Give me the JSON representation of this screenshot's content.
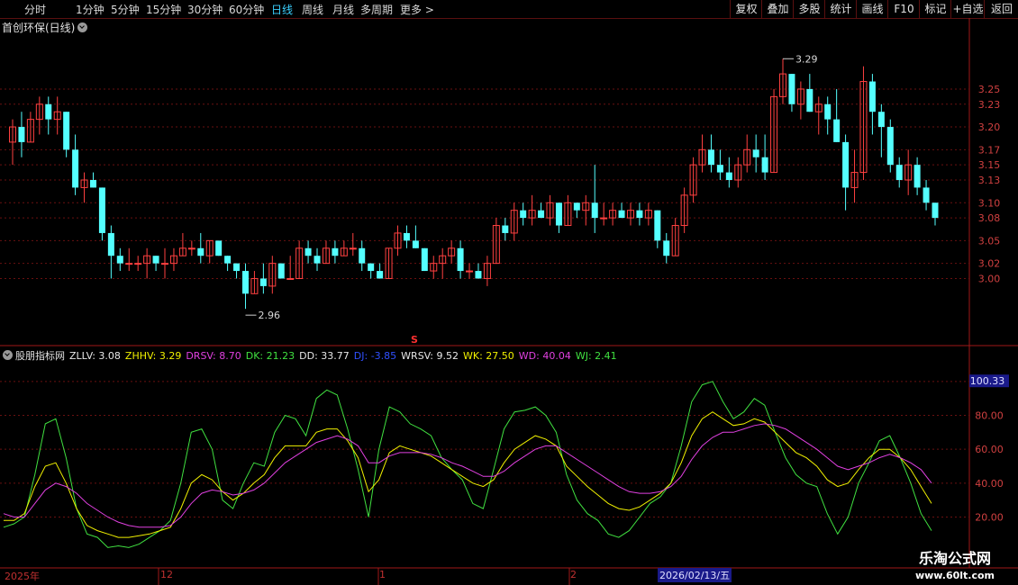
{
  "toolbar": {
    "periods": [
      "分时",
      "1分钟",
      "5分钟",
      "15分钟",
      "30分钟",
      "60分钟",
      "日线",
      "周线",
      "月线",
      "多周期",
      "更多 >"
    ],
    "active_period": "日线",
    "tools": [
      "复权",
      "叠加",
      "多股",
      "统计",
      "画线",
      "F10",
      "标记",
      "+自选",
      "返回"
    ]
  },
  "main_title": "首创环保(日线)",
  "price_axis": [
    "3.25",
    "3.23",
    "3.20",
    "3.17",
    "3.15",
    "3.13",
    "3.10",
    "3.08",
    "3.05",
    "3.02",
    "3.00"
  ],
  "high_label": "3.29",
  "low_label": "2.96",
  "marker_s": "S",
  "indicator": {
    "name": "股朋指标网",
    "values": [
      {
        "label": "ZLLV:",
        "value": "3.08",
        "color": "#e8e8e8"
      },
      {
        "label": "ZHHV:",
        "value": "3.29",
        "color": "#f0f000"
      },
      {
        "label": "DRSV:",
        "value": "8.70",
        "color": "#e040e0"
      },
      {
        "label": "DK:",
        "value": "21.23",
        "color": "#40e040"
      },
      {
        "label": "DD:",
        "value": "33.77",
        "color": "#e8e8e8"
      },
      {
        "label": "DJ:",
        "value": "-3.85",
        "color": "#3050ff"
      },
      {
        "label": "WRSV:",
        "value": "9.52",
        "color": "#e8e8e8"
      },
      {
        "label": "WK:",
        "value": "27.50",
        "color": "#f0f000"
      },
      {
        "label": "WD:",
        "value": "40.04",
        "color": "#e040e0"
      },
      {
        "label": "WJ:",
        "value": "2.41",
        "color": "#40e040"
      }
    ],
    "axis": [
      "100.00",
      "80.00",
      "60.00",
      "40.00",
      "20.00"
    ],
    "current": "100.33"
  },
  "date_labels": [
    "2025年",
    "12",
    "1",
    "2"
  ],
  "cursor_date": "2026/02/13/五",
  "watermark": {
    "line1": "乐淘公式网",
    "line2": "www.60lt.com"
  },
  "chart_data": [
    {
      "type": "candlestick",
      "title": "首创环保(日线)",
      "y_range": [
        2.94,
        3.32
      ],
      "candles": [
        [
          3.18,
          3.21,
          3.15,
          3.2
        ],
        [
          3.2,
          3.22,
          3.16,
          3.18
        ],
        [
          3.18,
          3.22,
          3.18,
          3.21
        ],
        [
          3.21,
          3.24,
          3.19,
          3.23
        ],
        [
          3.23,
          3.24,
          3.19,
          3.21
        ],
        [
          3.21,
          3.24,
          3.19,
          3.22
        ],
        [
          3.22,
          3.22,
          3.16,
          3.17
        ],
        [
          3.17,
          3.19,
          3.11,
          3.12
        ],
        [
          3.12,
          3.14,
          3.1,
          3.13
        ],
        [
          3.13,
          3.14,
          3.12,
          3.12
        ],
        [
          3.12,
          3.12,
          3.05,
          3.06
        ],
        [
          3.06,
          3.07,
          3.0,
          3.03
        ],
        [
          3.03,
          3.04,
          3.01,
          3.02
        ],
        [
          3.02,
          3.04,
          3.01,
          3.02
        ],
        [
          3.02,
          3.03,
          3.01,
          3.02
        ],
        [
          3.02,
          3.04,
          3.0,
          3.03
        ],
        [
          3.03,
          3.03,
          3.01,
          3.02
        ],
        [
          3.02,
          3.04,
          3.0,
          3.02
        ],
        [
          3.02,
          3.04,
          3.01,
          3.03
        ],
        [
          3.03,
          3.06,
          3.03,
          3.04
        ],
        [
          3.04,
          3.05,
          3.03,
          3.04
        ],
        [
          3.04,
          3.06,
          3.02,
          3.03
        ],
        [
          3.03,
          3.05,
          3.02,
          3.05
        ],
        [
          3.05,
          3.05,
          3.03,
          3.03
        ],
        [
          3.03,
          3.03,
          3.01,
          3.02
        ],
        [
          3.02,
          3.02,
          3.0,
          3.01
        ],
        [
          3.01,
          3.02,
          2.96,
          2.98
        ],
        [
          2.98,
          3.01,
          2.98,
          3.0
        ],
        [
          3.0,
          3.02,
          2.98,
          2.99
        ],
        [
          2.99,
          3.03,
          2.98,
          3.02
        ],
        [
          3.02,
          3.02,
          3.0,
          3.0
        ],
        [
          3.0,
          3.03,
          3.0,
          3.0
        ],
        [
          3.0,
          3.05,
          3.0,
          3.04
        ],
        [
          3.04,
          3.05,
          3.02,
          3.03
        ],
        [
          3.03,
          3.04,
          3.01,
          3.02
        ],
        [
          3.02,
          3.05,
          3.02,
          3.04
        ],
        [
          3.04,
          3.05,
          3.02,
          3.03
        ],
        [
          3.03,
          3.05,
          3.03,
          3.04
        ],
        [
          3.04,
          3.06,
          3.03,
          3.04
        ],
        [
          3.04,
          3.05,
          3.01,
          3.02
        ],
        [
          3.02,
          3.02,
          3.0,
          3.01
        ],
        [
          3.01,
          3.02,
          3.0,
          3.0
        ],
        [
          3.0,
          3.04,
          3.0,
          3.04
        ],
        [
          3.04,
          3.07,
          3.03,
          3.06
        ],
        [
          3.06,
          3.07,
          3.04,
          3.05
        ],
        [
          3.05,
          3.07,
          3.04,
          3.04
        ],
        [
          3.04,
          3.04,
          3.01,
          3.01
        ],
        [
          3.01,
          3.03,
          3.0,
          3.02
        ],
        [
          3.02,
          3.04,
          3.0,
          3.03
        ],
        [
          3.03,
          3.05,
          3.02,
          3.04
        ],
        [
          3.04,
          3.05,
          3.0,
          3.01
        ],
        [
          3.01,
          3.02,
          3.0,
          3.01
        ],
        [
          3.01,
          3.02,
          3.0,
          3.0
        ],
        [
          3.0,
          3.03,
          2.99,
          3.02
        ],
        [
          3.02,
          3.08,
          3.02,
          3.07
        ],
        [
          3.07,
          3.08,
          3.05,
          3.06
        ],
        [
          3.06,
          3.1,
          3.05,
          3.09
        ],
        [
          3.09,
          3.1,
          3.07,
          3.08
        ],
        [
          3.08,
          3.11,
          3.07,
          3.09
        ],
        [
          3.09,
          3.1,
          3.08,
          3.08
        ],
        [
          3.08,
          3.11,
          3.07,
          3.1
        ],
        [
          3.1,
          3.1,
          3.06,
          3.07
        ],
        [
          3.07,
          3.11,
          3.07,
          3.1
        ],
        [
          3.1,
          3.1,
          3.08,
          3.09
        ],
        [
          3.09,
          3.11,
          3.07,
          3.1
        ],
        [
          3.1,
          3.15,
          3.06,
          3.08
        ],
        [
          3.08,
          3.1,
          3.07,
          3.08
        ],
        [
          3.08,
          3.1,
          3.07,
          3.09
        ],
        [
          3.09,
          3.1,
          3.08,
          3.08
        ],
        [
          3.08,
          3.1,
          3.07,
          3.09
        ],
        [
          3.09,
          3.1,
          3.07,
          3.08
        ],
        [
          3.08,
          3.1,
          3.07,
          3.09
        ],
        [
          3.09,
          3.09,
          3.04,
          3.05
        ],
        [
          3.05,
          3.06,
          3.02,
          3.03
        ],
        [
          3.03,
          3.08,
          3.03,
          3.07
        ],
        [
          3.07,
          3.12,
          3.06,
          3.11
        ],
        [
          3.11,
          3.16,
          3.1,
          3.15
        ],
        [
          3.15,
          3.19,
          3.14,
          3.17
        ],
        [
          3.17,
          3.19,
          3.14,
          3.15
        ],
        [
          3.15,
          3.17,
          3.13,
          3.14
        ],
        [
          3.14,
          3.16,
          3.12,
          3.13
        ],
        [
          3.13,
          3.16,
          3.12,
          3.15
        ],
        [
          3.15,
          3.19,
          3.14,
          3.17
        ],
        [
          3.17,
          3.19,
          3.14,
          3.16
        ],
        [
          3.16,
          3.19,
          3.13,
          3.14
        ],
        [
          3.14,
          3.25,
          3.14,
          3.24
        ],
        [
          3.24,
          3.29,
          3.23,
          3.27
        ],
        [
          3.27,
          3.27,
          3.22,
          3.23
        ],
        [
          3.23,
          3.26,
          3.21,
          3.25
        ],
        [
          3.25,
          3.27,
          3.22,
          3.22
        ],
        [
          3.22,
          3.24,
          3.19,
          3.23
        ],
        [
          3.23,
          3.24,
          3.19,
          3.21
        ],
        [
          3.21,
          3.25,
          3.18,
          3.18
        ],
        [
          3.18,
          3.19,
          3.09,
          3.12
        ],
        [
          3.12,
          3.17,
          3.1,
          3.14
        ],
        [
          3.14,
          3.28,
          3.13,
          3.26
        ],
        [
          3.26,
          3.27,
          3.19,
          3.22
        ],
        [
          3.22,
          3.23,
          3.16,
          3.2
        ],
        [
          3.2,
          3.21,
          3.14,
          3.15
        ],
        [
          3.15,
          3.16,
          3.12,
          3.13
        ],
        [
          3.13,
          3.17,
          3.11,
          3.15
        ],
        [
          3.15,
          3.16,
          3.11,
          3.12
        ],
        [
          3.12,
          3.13,
          3.09,
          3.1
        ],
        [
          3.1,
          3.1,
          3.07,
          3.08
        ]
      ]
    },
    {
      "type": "line",
      "title": "股朋指标网",
      "y_range": [
        -10,
        110
      ],
      "series": [
        {
          "name": "DK",
          "color": "#40e040",
          "values": [
            14,
            16,
            20,
            45,
            75,
            78,
            55,
            25,
            10,
            8,
            2,
            3,
            2,
            4,
            8,
            12,
            18,
            40,
            70,
            72,
            60,
            30,
            25,
            40,
            52,
            50,
            70,
            80,
            78,
            68,
            90,
            95,
            92,
            72,
            48,
            20,
            60,
            85,
            82,
            75,
            72,
            68,
            55,
            48,
            42,
            28,
            25,
            48,
            72,
            82,
            83,
            85,
            80,
            70,
            45,
            30,
            22,
            18,
            10,
            8,
            12,
            20,
            28,
            32,
            40,
            62,
            88,
            98,
            100,
            88,
            78,
            82,
            90,
            86,
            70,
            55,
            45,
            40,
            38,
            22,
            10,
            20,
            40,
            52,
            65,
            68,
            55,
            40,
            22,
            12
          ]
        },
        {
          "name": "WK",
          "color": "#f0f000",
          "values": [
            18,
            18,
            22,
            38,
            50,
            52,
            40,
            25,
            15,
            12,
            10,
            8,
            8,
            9,
            10,
            12,
            14,
            25,
            40,
            45,
            42,
            35,
            30,
            34,
            40,
            45,
            55,
            62,
            62,
            62,
            70,
            72,
            72,
            65,
            55,
            35,
            42,
            58,
            62,
            60,
            58,
            56,
            52,
            48,
            44,
            40,
            38,
            42,
            52,
            60,
            64,
            68,
            66,
            62,
            50,
            44,
            38,
            33,
            28,
            25,
            24,
            26,
            30,
            34,
            40,
            52,
            68,
            78,
            82,
            78,
            74,
            75,
            78,
            76,
            70,
            64,
            58,
            55,
            50,
            42,
            38,
            40,
            48,
            55,
            60,
            60,
            55,
            48,
            38,
            28
          ]
        },
        {
          "name": "WD",
          "color": "#e040e0",
          "values": [
            22,
            20,
            20,
            28,
            36,
            40,
            38,
            34,
            28,
            24,
            20,
            17,
            15,
            14,
            14,
            14,
            15,
            20,
            28,
            34,
            36,
            35,
            33,
            34,
            36,
            40,
            46,
            52,
            56,
            60,
            64,
            66,
            68,
            66,
            62,
            52,
            52,
            56,
            58,
            58,
            58,
            57,
            55,
            52,
            50,
            47,
            44,
            44,
            47,
            52,
            56,
            60,
            62,
            62,
            58,
            54,
            50,
            46,
            42,
            38,
            35,
            34,
            34,
            35,
            38,
            44,
            54,
            62,
            67,
            70,
            70,
            72,
            74,
            75,
            74,
            72,
            68,
            64,
            60,
            55,
            50,
            48,
            50,
            52,
            55,
            57,
            55,
            52,
            48,
            40
          ]
        }
      ]
    }
  ]
}
